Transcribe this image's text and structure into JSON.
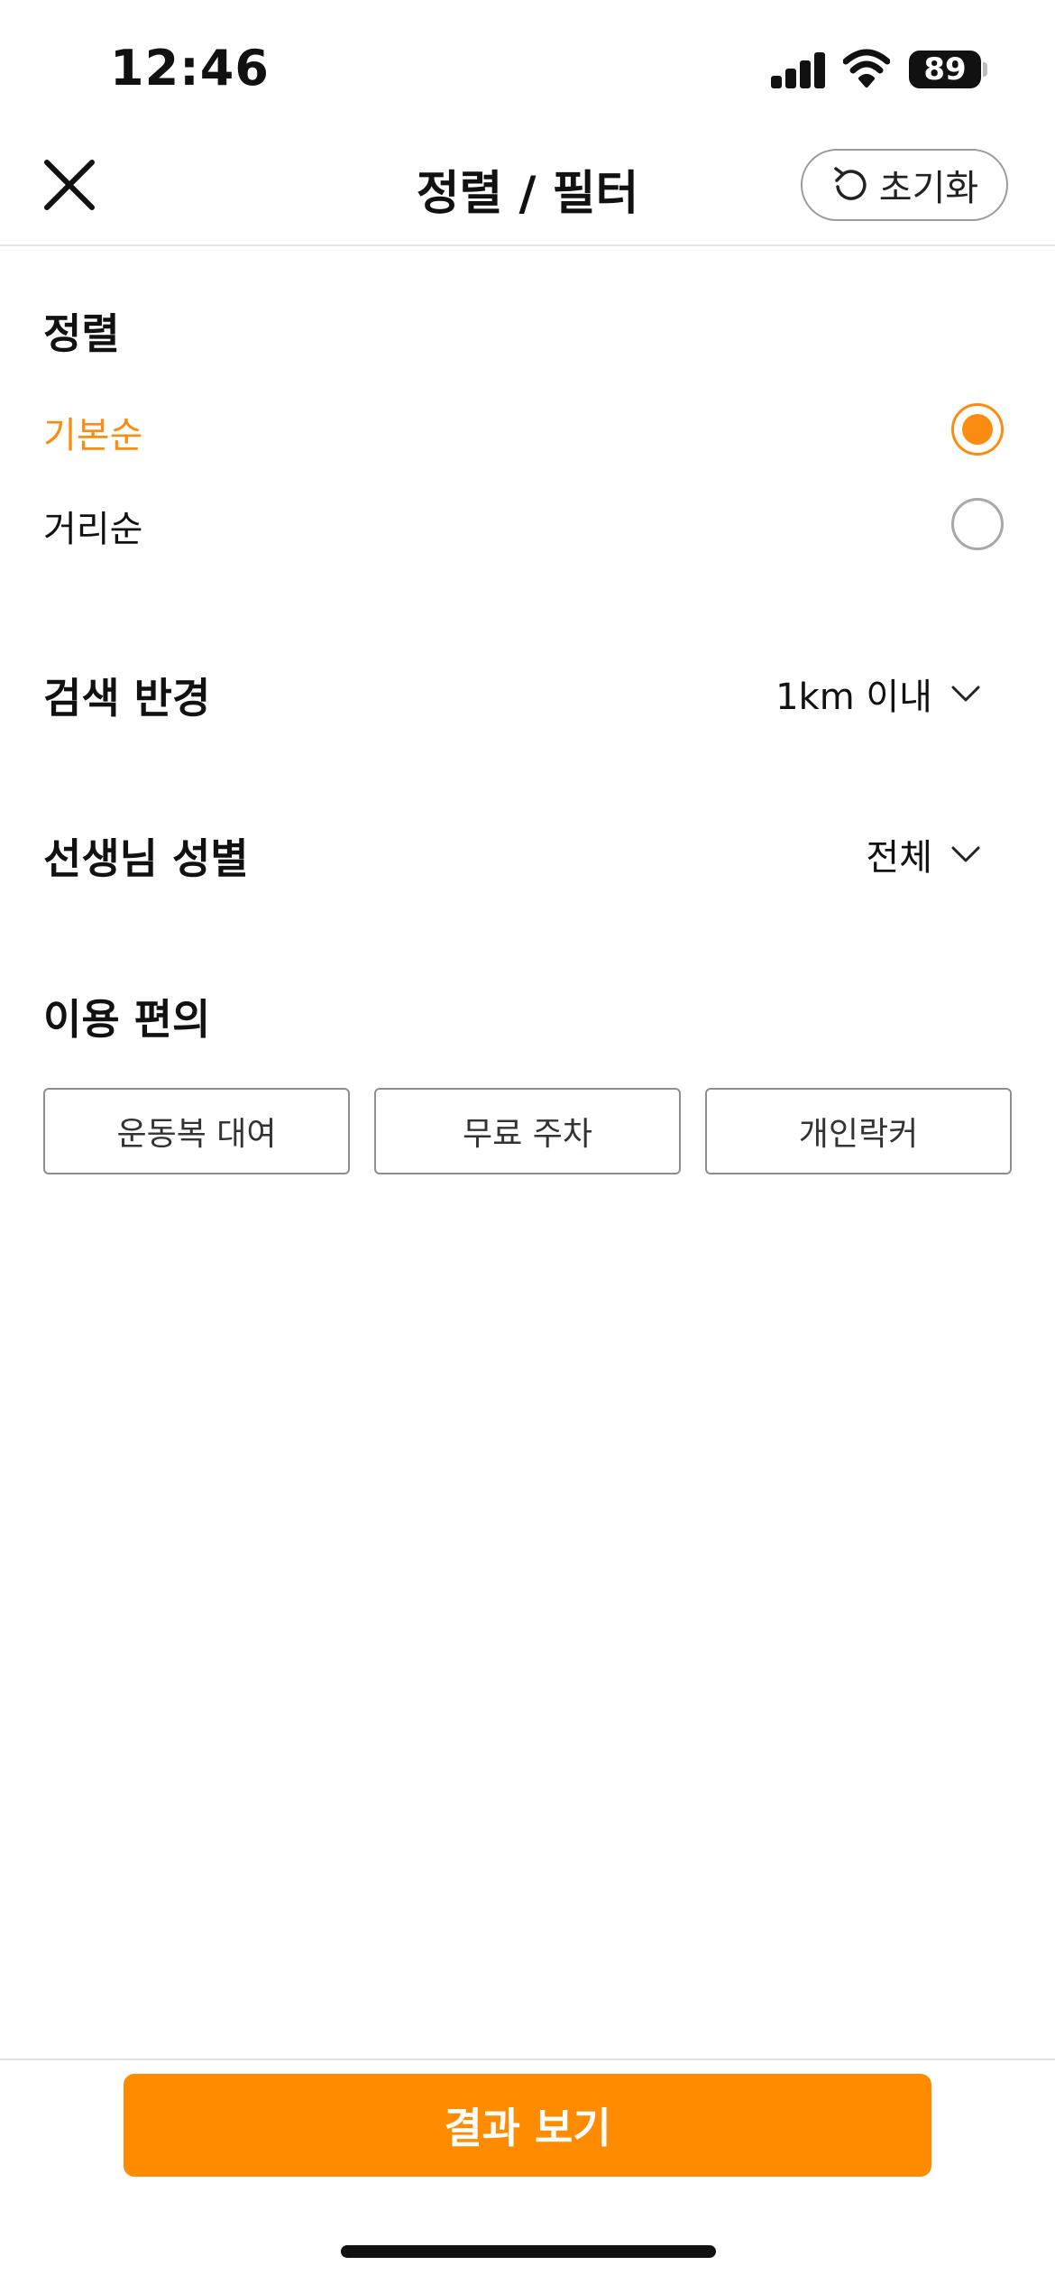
{
  "status_bar": {
    "time": "12:46",
    "battery": "89"
  },
  "header": {
    "title": "정렬 / 필터",
    "reset_label": "초기화"
  },
  "sort": {
    "title": "정렬",
    "options": [
      {
        "label": "기본순",
        "selected": true
      },
      {
        "label": "거리순",
        "selected": false
      }
    ]
  },
  "radius": {
    "title": "검색 반경",
    "value": "1km 이내"
  },
  "gender": {
    "title": "선생님 성별",
    "value": "전체"
  },
  "amenities": {
    "title": "이용 편의",
    "chips": [
      "운동복 대여",
      "무료 주차",
      "개인락커"
    ]
  },
  "footer": {
    "button_label": "결과 보기"
  },
  "colors": {
    "accent": "#FF8B00",
    "radio_selected": "#FB8C12"
  }
}
